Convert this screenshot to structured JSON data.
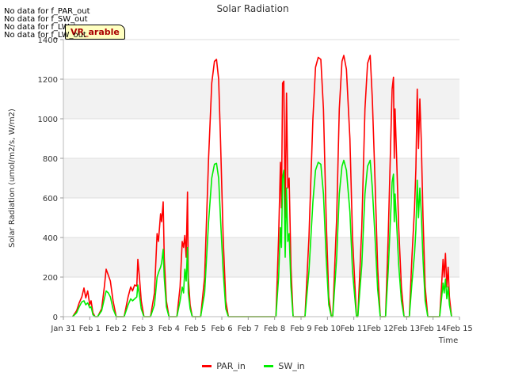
{
  "no_data_messages": [
    "No data for f_PAR_out",
    "No data for f_SW_out",
    "No data for f_LW_in",
    "No data for f_LW_out"
  ],
  "badge_text": "VR_arable",
  "chart_data": {
    "type": "line",
    "title": "Solar Radiation",
    "xlabel": "Time",
    "ylabel": "Solar Radiation (umol/m2/s, W/m2)",
    "x_tick_labels": [
      "Jan 31",
      "Feb 1",
      "Feb 2",
      "Feb 3",
      "Feb 4",
      "Feb 5",
      "Feb 6",
      "Feb 7",
      "Feb 8",
      "Feb 9",
      "Feb 10",
      "Feb 11",
      "Feb 12",
      "Feb 13",
      "Feb 14",
      "Feb 15"
    ],
    "xlim": [
      0,
      15
    ],
    "ylim": [
      0,
      1400
    ],
    "y_ticks": [
      0,
      200,
      400,
      600,
      800,
      1000,
      1200,
      1400
    ],
    "grid": true,
    "legend_position": "bottom-center",
    "series": [
      {
        "name": "PAR_in",
        "color": "#ff0000",
        "points": [
          [
            0.35,
            0
          ],
          [
            0.5,
            30
          ],
          [
            0.6,
            70
          ],
          [
            0.7,
            100
          ],
          [
            0.78,
            145
          ],
          [
            0.85,
            95
          ],
          [
            0.92,
            130
          ],
          [
            1.0,
            60
          ],
          [
            1.05,
            80
          ],
          [
            1.12,
            20
          ],
          [
            1.2,
            0
          ],
          [
            1.3,
            0
          ],
          [
            1.45,
            40
          ],
          [
            1.55,
            150
          ],
          [
            1.62,
            240
          ],
          [
            1.7,
            210
          ],
          [
            1.78,
            180
          ],
          [
            1.88,
            80
          ],
          [
            2.0,
            0
          ],
          [
            2.3,
            0
          ],
          [
            2.45,
            100
          ],
          [
            2.55,
            150
          ],
          [
            2.62,
            130
          ],
          [
            2.7,
            160
          ],
          [
            2.78,
            155
          ],
          [
            2.82,
            290
          ],
          [
            2.88,
            200
          ],
          [
            2.95,
            80
          ],
          [
            3.05,
            0
          ],
          [
            3.3,
            0
          ],
          [
            3.45,
            120
          ],
          [
            3.55,
            420
          ],
          [
            3.6,
            380
          ],
          [
            3.68,
            520
          ],
          [
            3.72,
            480
          ],
          [
            3.78,
            580
          ],
          [
            3.82,
            300
          ],
          [
            3.9,
            80
          ],
          [
            4.0,
            0
          ],
          [
            4.3,
            0
          ],
          [
            4.42,
            150
          ],
          [
            4.5,
            380
          ],
          [
            4.55,
            350
          ],
          [
            4.6,
            410
          ],
          [
            4.65,
            300
          ],
          [
            4.7,
            630
          ],
          [
            4.73,
            200
          ],
          [
            4.8,
            60
          ],
          [
            4.88,
            0
          ],
          [
            5.2,
            0
          ],
          [
            5.35,
            200
          ],
          [
            5.5,
            800
          ],
          [
            5.62,
            1180
          ],
          [
            5.72,
            1290
          ],
          [
            5.8,
            1300
          ],
          [
            5.88,
            1200
          ],
          [
            5.95,
            900
          ],
          [
            6.05,
            400
          ],
          [
            6.15,
            80
          ],
          [
            6.25,
            0
          ],
          [
            8.05,
            0
          ],
          [
            8.15,
            400
          ],
          [
            8.22,
            780
          ],
          [
            8.26,
            550
          ],
          [
            8.3,
            1180
          ],
          [
            8.35,
            1190
          ],
          [
            8.4,
            500
          ],
          [
            8.45,
            1130
          ],
          [
            8.5,
            650
          ],
          [
            8.55,
            700
          ],
          [
            8.62,
            250
          ],
          [
            8.7,
            0
          ],
          [
            9.15,
            0
          ],
          [
            9.3,
            400
          ],
          [
            9.45,
            1000
          ],
          [
            9.55,
            1260
          ],
          [
            9.65,
            1310
          ],
          [
            9.75,
            1300
          ],
          [
            9.85,
            1050
          ],
          [
            9.95,
            500
          ],
          [
            10.05,
            100
          ],
          [
            10.15,
            0
          ],
          [
            10.2,
            0
          ],
          [
            10.35,
            500
          ],
          [
            10.45,
            1050
          ],
          [
            10.55,
            1290
          ],
          [
            10.62,
            1320
          ],
          [
            10.72,
            1250
          ],
          [
            10.85,
            900
          ],
          [
            10.95,
            400
          ],
          [
            11.1,
            0
          ],
          [
            11.15,
            0
          ],
          [
            11.3,
            450
          ],
          [
            11.42,
            1050
          ],
          [
            11.52,
            1280
          ],
          [
            11.62,
            1320
          ],
          [
            11.7,
            1100
          ],
          [
            11.8,
            700
          ],
          [
            11.9,
            250
          ],
          [
            12.0,
            0
          ],
          [
            12.2,
            0
          ],
          [
            12.3,
            400
          ],
          [
            12.4,
            900
          ],
          [
            12.45,
            1150
          ],
          [
            12.5,
            1210
          ],
          [
            12.53,
            800
          ],
          [
            12.56,
            1050
          ],
          [
            12.62,
            800
          ],
          [
            12.7,
            450
          ],
          [
            12.8,
            150
          ],
          [
            12.9,
            0
          ],
          [
            13.1,
            0
          ],
          [
            13.2,
            300
          ],
          [
            13.3,
            550
          ],
          [
            13.35,
            750
          ],
          [
            13.4,
            1150
          ],
          [
            13.45,
            850
          ],
          [
            13.5,
            1100
          ],
          [
            13.55,
            900
          ],
          [
            13.62,
            500
          ],
          [
            13.7,
            150
          ],
          [
            13.8,
            0
          ],
          [
            14.25,
            0
          ],
          [
            14.32,
            150
          ],
          [
            14.38,
            290
          ],
          [
            14.42,
            200
          ],
          [
            14.47,
            320
          ],
          [
            14.52,
            150
          ],
          [
            14.57,
            250
          ],
          [
            14.62,
            100
          ],
          [
            14.7,
            0
          ]
        ]
      },
      {
        "name": "SW_in",
        "color": "#00ee00",
        "points": [
          [
            0.35,
            0
          ],
          [
            0.5,
            20
          ],
          [
            0.6,
            50
          ],
          [
            0.7,
            75
          ],
          [
            0.78,
            80
          ],
          [
            0.85,
            60
          ],
          [
            0.92,
            70
          ],
          [
            1.0,
            45
          ],
          [
            1.05,
            50
          ],
          [
            1.12,
            10
          ],
          [
            1.2,
            0
          ],
          [
            1.3,
            0
          ],
          [
            1.45,
            30
          ],
          [
            1.55,
            90
          ],
          [
            1.62,
            130
          ],
          [
            1.7,
            120
          ],
          [
            1.78,
            100
          ],
          [
            1.88,
            40
          ],
          [
            2.0,
            0
          ],
          [
            2.3,
            0
          ],
          [
            2.45,
            60
          ],
          [
            2.55,
            90
          ],
          [
            2.62,
            80
          ],
          [
            2.7,
            90
          ],
          [
            2.78,
            100
          ],
          [
            2.82,
            160
          ],
          [
            2.88,
            110
          ],
          [
            2.95,
            40
          ],
          [
            3.05,
            0
          ],
          [
            3.3,
            0
          ],
          [
            3.45,
            60
          ],
          [
            3.55,
            200
          ],
          [
            3.62,
            230
          ],
          [
            3.68,
            250
          ],
          [
            3.72,
            270
          ],
          [
            3.78,
            340
          ],
          [
            3.82,
            200
          ],
          [
            3.9,
            50
          ],
          [
            4.0,
            0
          ],
          [
            4.3,
            0
          ],
          [
            4.42,
            80
          ],
          [
            4.5,
            150
          ],
          [
            4.55,
            120
          ],
          [
            4.6,
            240
          ],
          [
            4.65,
            180
          ],
          [
            4.7,
            350
          ],
          [
            4.73,
            120
          ],
          [
            4.8,
            40
          ],
          [
            4.88,
            0
          ],
          [
            5.2,
            0
          ],
          [
            5.35,
            120
          ],
          [
            5.5,
            480
          ],
          [
            5.62,
            700
          ],
          [
            5.72,
            770
          ],
          [
            5.8,
            775
          ],
          [
            5.88,
            700
          ],
          [
            5.95,
            500
          ],
          [
            6.05,
            230
          ],
          [
            6.15,
            40
          ],
          [
            6.25,
            0
          ],
          [
            8.05,
            0
          ],
          [
            8.15,
            200
          ],
          [
            8.22,
            450
          ],
          [
            8.26,
            350
          ],
          [
            8.3,
            700
          ],
          [
            8.35,
            740
          ],
          [
            8.4,
            300
          ],
          [
            8.45,
            650
          ],
          [
            8.5,
            380
          ],
          [
            8.55,
            420
          ],
          [
            8.62,
            150
          ],
          [
            8.7,
            0
          ],
          [
            9.15,
            0
          ],
          [
            9.3,
            230
          ],
          [
            9.45,
            580
          ],
          [
            9.55,
            740
          ],
          [
            9.65,
            780
          ],
          [
            9.75,
            770
          ],
          [
            9.85,
            620
          ],
          [
            9.95,
            300
          ],
          [
            10.05,
            60
          ],
          [
            10.15,
            0
          ],
          [
            10.2,
            0
          ],
          [
            10.35,
            300
          ],
          [
            10.45,
            620
          ],
          [
            10.55,
            760
          ],
          [
            10.62,
            790
          ],
          [
            10.72,
            740
          ],
          [
            10.85,
            530
          ],
          [
            10.95,
            230
          ],
          [
            11.1,
            0
          ],
          [
            11.15,
            0
          ],
          [
            11.3,
            260
          ],
          [
            11.42,
            620
          ],
          [
            11.52,
            760
          ],
          [
            11.62,
            790
          ],
          [
            11.7,
            650
          ],
          [
            11.8,
            410
          ],
          [
            11.9,
            140
          ],
          [
            12.0,
            0
          ],
          [
            12.2,
            0
          ],
          [
            12.3,
            230
          ],
          [
            12.4,
            530
          ],
          [
            12.45,
            680
          ],
          [
            12.5,
            720
          ],
          [
            12.53,
            480
          ],
          [
            12.56,
            620
          ],
          [
            12.62,
            470
          ],
          [
            12.7,
            260
          ],
          [
            12.8,
            80
          ],
          [
            12.9,
            0
          ],
          [
            13.1,
            0
          ],
          [
            13.2,
            170
          ],
          [
            13.3,
            320
          ],
          [
            13.35,
            440
          ],
          [
            13.4,
            690
          ],
          [
            13.45,
            500
          ],
          [
            13.5,
            650
          ],
          [
            13.55,
            530
          ],
          [
            13.62,
            290
          ],
          [
            13.7,
            80
          ],
          [
            13.8,
            0
          ],
          [
            14.25,
            0
          ],
          [
            14.32,
            90
          ],
          [
            14.38,
            170
          ],
          [
            14.42,
            120
          ],
          [
            14.47,
            190
          ],
          [
            14.52,
            90
          ],
          [
            14.57,
            150
          ],
          [
            14.62,
            60
          ],
          [
            14.7,
            0
          ]
        ]
      }
    ]
  }
}
